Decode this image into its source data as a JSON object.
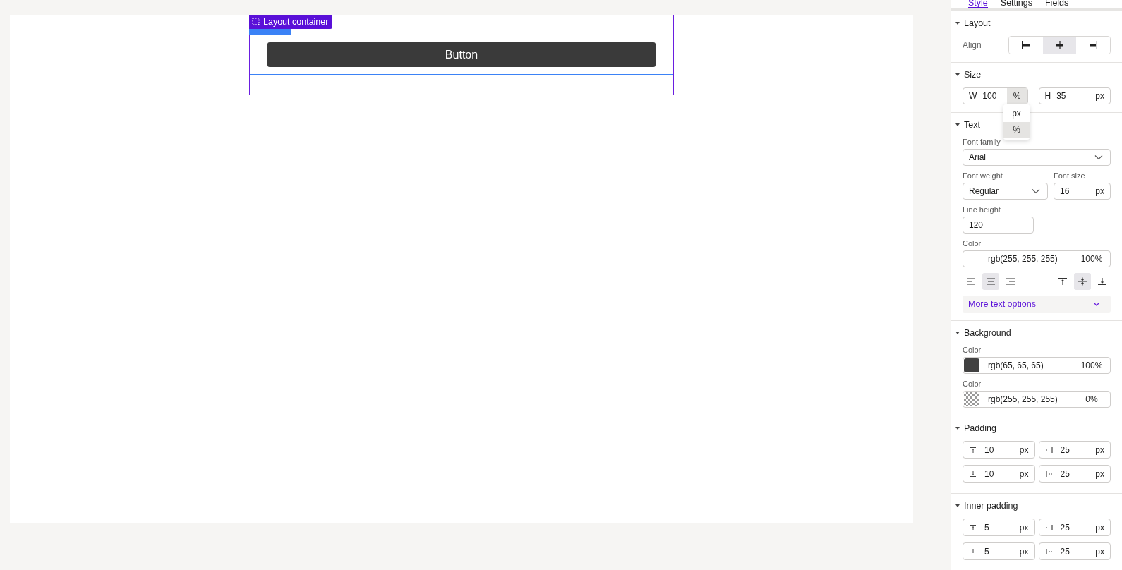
{
  "canvas": {
    "container_label": "Layout container",
    "button_label": "Button"
  },
  "tabs": [
    {
      "label": "Style",
      "selected": true
    },
    {
      "label": "Settings",
      "selected": false
    },
    {
      "label": "Fields",
      "selected": false
    }
  ],
  "layout": {
    "title": "Layout",
    "expanded": true,
    "align_label": "Align",
    "align": [
      {
        "kind": "left",
        "selected": false
      },
      {
        "kind": "center",
        "selected": true
      },
      {
        "kind": "right",
        "selected": false
      }
    ]
  },
  "size": {
    "title": "Size",
    "expanded": true,
    "width": {
      "prefix": "W",
      "value": "100",
      "unit": "%"
    },
    "height": {
      "prefix": "H",
      "value": "35",
      "unit": "px"
    },
    "unit_menu": [
      {
        "label": "px",
        "selected": false
      },
      {
        "label": "%",
        "selected": true
      }
    ]
  },
  "text": {
    "title": "Text",
    "expanded": true,
    "font_family": {
      "label": "Font family",
      "value": "Arial"
    },
    "font_weight": {
      "label": "Font weight",
      "value": "Regular"
    },
    "font_size": {
      "label": "Font size",
      "value": "16",
      "unit": "px"
    },
    "line_height": {
      "label": "Line height",
      "value": "120"
    },
    "color": {
      "label": "Color",
      "value": "rgb(255, 255, 255)",
      "opacity": "100%"
    },
    "h_align": [
      {
        "kind": "left",
        "selected": false
      },
      {
        "kind": "center",
        "selected": true
      },
      {
        "kind": "right",
        "selected": false
      }
    ],
    "v_align": [
      {
        "kind": "top",
        "selected": false
      },
      {
        "kind": "middle",
        "selected": true
      },
      {
        "kind": "bottom",
        "selected": false
      }
    ],
    "more": "More text options"
  },
  "background": {
    "title": "Background",
    "expanded": true,
    "colors": [
      {
        "label": "Color",
        "color": "#414141",
        "kind": "solid",
        "value": "rgb(65, 65, 65)",
        "opacity": "100%"
      },
      {
        "label": "Color",
        "kind": "transparent",
        "value": "rgb(255, 255, 255)",
        "opacity": "0%"
      }
    ]
  },
  "padding": {
    "title": "Padding",
    "expanded": true,
    "fields": [
      {
        "kind": "top",
        "value": "10",
        "unit": "px"
      },
      {
        "kind": "right",
        "value": "25",
        "unit": "px"
      },
      {
        "kind": "bottom",
        "value": "10",
        "unit": "px"
      },
      {
        "kind": "left",
        "value": "25",
        "unit": "px"
      }
    ]
  },
  "inner_padding": {
    "title": "Inner padding",
    "expanded": true,
    "fields": [
      {
        "kind": "top",
        "value": "5",
        "unit": "px"
      },
      {
        "kind": "right",
        "value": "25",
        "unit": "px"
      },
      {
        "kind": "bottom",
        "value": "5",
        "unit": "px"
      },
      {
        "kind": "left",
        "value": "25",
        "unit": "px"
      }
    ]
  }
}
